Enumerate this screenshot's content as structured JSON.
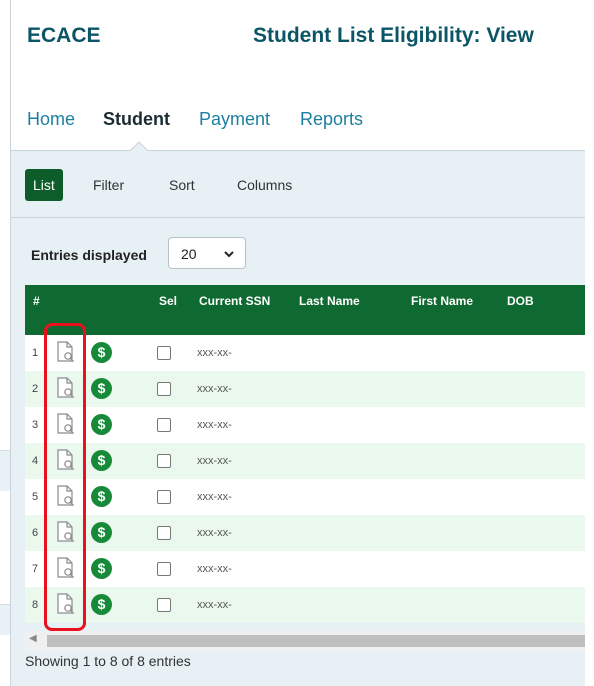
{
  "header": {
    "brand": "ECACE",
    "page_title": "Student List Eligibility: View"
  },
  "nav": {
    "items": [
      {
        "label": "Home",
        "active": false
      },
      {
        "label": "Student",
        "active": true
      },
      {
        "label": "Payment",
        "active": false
      },
      {
        "label": "Reports",
        "active": false
      }
    ]
  },
  "subnav": {
    "tabs": [
      {
        "label": "List",
        "active": true
      },
      {
        "label": "Filter",
        "active": false
      },
      {
        "label": "Sort",
        "active": false
      },
      {
        "label": "Columns",
        "active": false
      }
    ]
  },
  "entries": {
    "label": "Entries displayed",
    "selected": "20"
  },
  "table": {
    "columns": [
      "#",
      "Sel",
      "Current SSN",
      "Last Name",
      "First Name",
      "DOB"
    ],
    "rows": [
      {
        "num": "1",
        "ssn": "xxx-xx-"
      },
      {
        "num": "2",
        "ssn": "xxx-xx-"
      },
      {
        "num": "3",
        "ssn": "xxx-xx-"
      },
      {
        "num": "4",
        "ssn": "xxx-xx-"
      },
      {
        "num": "5",
        "ssn": "xxx-xx-"
      },
      {
        "num": "6",
        "ssn": "xxx-xx-"
      },
      {
        "num": "7",
        "ssn": "xxx-xx-"
      },
      {
        "num": "8",
        "ssn": "xxx-xx-"
      }
    ]
  },
  "footer": {
    "summary": "Showing 1 to 8 of 8 entries"
  },
  "icons": {
    "view": "document-search-icon",
    "payment": "dollar-icon",
    "select": "checkbox"
  },
  "colors": {
    "brand": "#0b5567",
    "table_header": "#0f6a32",
    "active_tab": "#0d5d2b",
    "highlight": "#e8121e",
    "row_alt": "#eaf8ee"
  }
}
